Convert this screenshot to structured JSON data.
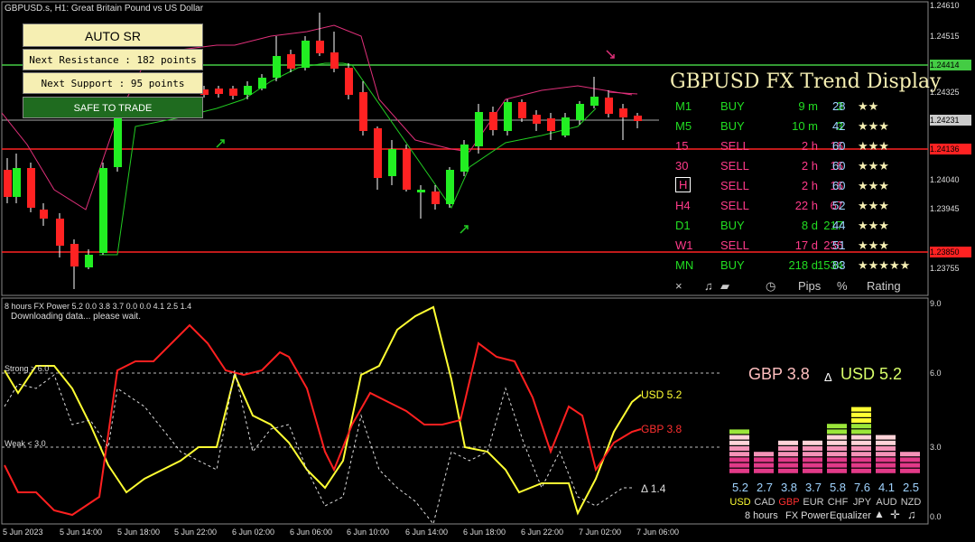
{
  "header": {
    "symbol_title": "GBPUSD.s, H1:  Great Britain Pound vs US Dollar"
  },
  "sr_panel": {
    "title": "AUTO SR",
    "resistance": "Next Resistance : 182 points",
    "support": "Next Support : 95 points",
    "status": "SAFE TO TRADE"
  },
  "trend": {
    "title": "GBPUSD FX Trend Display",
    "rows": [
      {
        "tf": "M1",
        "signal": "BUY",
        "dur": "9 m",
        "pips": "3",
        "pct": "28",
        "stars": "★★",
        "color": "#22dd22"
      },
      {
        "tf": "M5",
        "signal": "BUY",
        "dur": "10 m",
        "pips": "3",
        "pct": "42",
        "stars": "★★★",
        "color": "#22dd22"
      },
      {
        "tf": "15",
        "signal": "SELL",
        "dur": "2 h",
        "pips": "16",
        "pct": "60",
        "stars": "★★★",
        "color": "#ff3b8a"
      },
      {
        "tf": "30",
        "signal": "SELL",
        "dur": "2 h",
        "pips": "16",
        "pct": "60",
        "stars": "★★★",
        "color": "#ff3b8a"
      },
      {
        "tf": "H",
        "signal": "SELL",
        "dur": "2 h",
        "pips": "16",
        "pct": "60",
        "stars": "★★★",
        "color": "#ff3b8a"
      },
      {
        "tf": "H4",
        "signal": "SELL",
        "dur": "22 h",
        "pips": "67",
        "pct": "52",
        "stars": "★★★",
        "color": "#ff3b8a"
      },
      {
        "tf": "D1",
        "signal": "BUY",
        "dur": "8 d",
        "pips": "217",
        "pct": "44",
        "stars": "★★★",
        "color": "#22dd22"
      },
      {
        "tf": "W1",
        "signal": "SELL",
        "dur": "17 d",
        "pips": "236",
        "pct": "51",
        "stars": "★★★",
        "color": "#ff3b8a"
      },
      {
        "tf": "MN",
        "signal": "BUY",
        "dur": "218 d",
        "pips": "1534",
        "pct": "83",
        "stars": "★★★★★",
        "color": "#22dd22"
      }
    ],
    "footer": {
      "close": "×",
      "sound": "♫",
      "pips": "Pips",
      "pct": "%",
      "rating": "Rating"
    }
  },
  "price_axis": {
    "labels": [
      "1.24610",
      "1.24515",
      "1.24325",
      "1.24040",
      "1.23945",
      "1.23755"
    ],
    "boxes": [
      {
        "text": "1.24414",
        "bg": "#44cc44"
      },
      {
        "text": "1.24231",
        "bg": "#cccccc"
      },
      {
        "text": "1.24136",
        "bg": "#ff2222"
      },
      {
        "text": "1.23850",
        "bg": "#ff2222"
      }
    ]
  },
  "time_axis": [
    "5 Jun 2023",
    "5 Jun 14:00",
    "5 Jun 18:00",
    "5 Jun 22:00",
    "6 Jun 02:00",
    "6 Jun 06:00",
    "6 Jun 10:00",
    "6 Jun 14:00",
    "6 Jun 18:00",
    "6 Jun 22:00",
    "7 Jun 02:00",
    "7 Jun 06:00"
  ],
  "indicator": {
    "title": "8 hours FX Power 5.2 0.0 3.8 3.7 0.0 0.0 4.1 2.5 1.4",
    "status": "Downloading data... please wait.",
    "strong_label": "Strong > 6.0",
    "weak_label": "Weak < 3.0",
    "axis": [
      "9.0",
      "6.0",
      "3.0",
      "0.0"
    ],
    "usd_label": "USD 5.2",
    "gbp_label": "GBP 3.8",
    "delta_label": "Δ 1.4",
    "pair_gbp": "GBP 3.8",
    "pair_delta": "Δ",
    "pair_usd": "USD 5.2",
    "colors": {
      "usd": "#ffff33",
      "gbp": "#ff2020",
      "delta": "#dddddd"
    },
    "equalizer": {
      "values": [
        "5.2",
        "2.7",
        "3.8",
        "3.7",
        "5.8",
        "7.6",
        "4.1",
        "2.5"
      ],
      "levels": [
        5.2,
        2.7,
        3.8,
        3.7,
        5.8,
        7.6,
        4.1,
        2.5
      ],
      "currencies": [
        "USD",
        "CAD",
        "GBP",
        "EUR",
        "CHF",
        "JPY",
        "AUD",
        "NZD"
      ],
      "footer": [
        "8 hours",
        "FX Power",
        "Equalizer"
      ]
    }
  }
}
